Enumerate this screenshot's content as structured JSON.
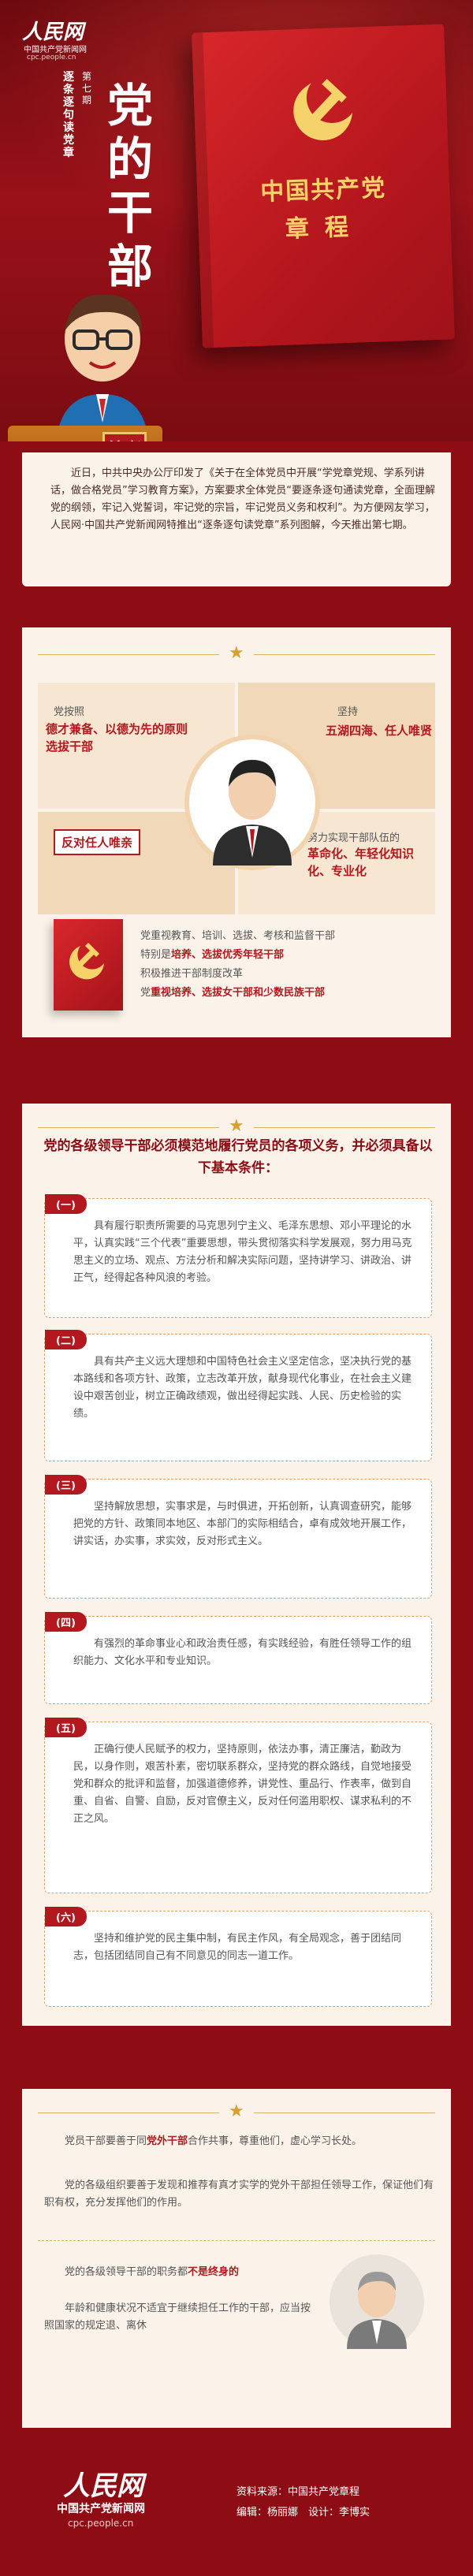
{
  "header": {
    "logo": "人民网",
    "logo_sub": "中国共产党新闻网",
    "logo_url": "cpc.people.cn",
    "series": "逐条逐句读党章",
    "episode": "第七期",
    "title": "党的干部",
    "book_title": "中国共产党",
    "book_subtitle": "章程",
    "editor_badge": "编者按"
  },
  "intro": {
    "paragraph": "近日，中共中央办公厅印发了《关于在全体党员中开展“学党章党规、学系列讲话，做合格党员”学习教育方案》，方案要求全体党员“要逐条逐句通读党章，全面理解党的纲领，牢记入党誓词，牢记党的宗旨，牢记党员义务和权利”。为方便网友学习，人民网·中国共产党新闻网特推出“逐条逐句读党章”系列图解，今天推出第七期。"
  },
  "section1": {
    "q1_label": "党按照",
    "q1_red": "德才兼备、以德为先的原则选拔干部",
    "q2_label": "坚持",
    "q2_red": "五湖四海、任人唯贤",
    "q3_box": "反对任人唯亲",
    "q4_label": "努力实现干部队伍的",
    "q4_red": "革命化、年轻化知识化、专业化",
    "line1": "党重视教育、培训、选拔、考核和监督干部",
    "line2_prefix": "特别是",
    "line2_bold": "培养、选拔优秀年轻干部",
    "line3": "积极推进干部制度改革",
    "line4_prefix": "党",
    "line4_bold": "重视培养、选拔女干部和少数民族干部"
  },
  "section2": {
    "heading": "党的各级领导干部必须模范地履行党员的各项义务，并必须具备以下基本条件：",
    "items": [
      {
        "badge": "(一)",
        "text": "具有履行职责所需要的马克思列宁主义、毛泽东思想、邓小平理论的水平，认真实践“三个代表”重要思想，带头贯彻落实科学发展观，努力用马克思主义的立场、观点、方法分析和解决实际问题，坚持讲学习、讲政治、讲正气，经得起各种风浪的考验。"
      },
      {
        "badge": "(二)",
        "text": "具有共产主义远大理想和中国特色社会主义坚定信念，坚决执行党的基本路线和各项方针、政策，立志改革开放，献身现代化事业，在社会主义建设中艰苦创业，树立正确政绩观，做出经得起实践、人民、历史检验的实绩。"
      },
      {
        "badge": "(三)",
        "text": "坚持解放思想，实事求是，与时俱进，开拓创新，认真调查研究，能够把党的方针、政策同本地区、本部门的实际相结合，卓有成效地开展工作，讲实话，办实事，求实效，反对形式主义。"
      },
      {
        "badge": "(四)",
        "text": "有强烈的革命事业心和政治责任感，有实践经验，有胜任领导工作的组织能力、文化水平和专业知识。"
      },
      {
        "badge": "(五)",
        "text": "正确行使人民赋予的权力，坚持原则，依法办事，清正廉洁，勤政为民，以身作则，艰苦朴素，密切联系群众，坚持党的群众路线，自觉地接受党和群众的批评和监督，加强道德修养，讲党性、重品行、作表率，做到自重、自省、自警、自励，反对官僚主义，反对任何滥用职权、谋求私利的不正之风。"
      },
      {
        "badge": "(六)",
        "text": "坚持和维护党的民主集中制，有民主作风，有全局观念，善于团结同志，包括团结同自己有不同意见的同志一道工作。"
      }
    ]
  },
  "section3": {
    "p1_a": "党员干部要善于同",
    "p1_b": "党外干部",
    "p1_c": "合作共事，尊重他们，虚心学习长处。",
    "p2": "党的各级组织要善于发现和推荐有真才实学的党外干部担任领导工作，保证他们有职有权，充分发挥他们的作用。",
    "p3_a": "党的各级领导干部的职务都",
    "p3_b": "不是终身的",
    "p4": "年龄和健康状况不适宜于继续担任工作的干部，应当按照国家的规定退、离休"
  },
  "footer": {
    "logo": "人民网",
    "logo_sub": "中国共产党新闻网",
    "logo_url": "cpc.people.cn",
    "source": "资料来源：中国共产党章程",
    "credits": "编辑：杨丽娜　设计：李博实"
  },
  "colors": {
    "brand_red": "#b3181f",
    "gold": "#f6d26a",
    "cream": "#fbf3ea"
  }
}
